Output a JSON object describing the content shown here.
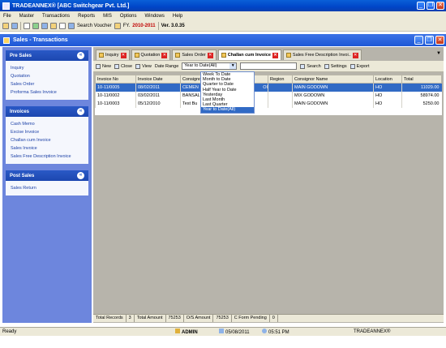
{
  "window": {
    "title": "TRADEANNEX® [ABC Switchgear Pvt. Ltd.]",
    "minimize": "_",
    "restore": "❐",
    "close": "✕"
  },
  "menu": [
    "File",
    "Master",
    "Transactions",
    "Reports",
    "MIS",
    "Options",
    "Windows",
    "Help"
  ],
  "toolbar": {
    "search_voucher": "Search Voucher",
    "fy_label": "FY.",
    "fy_value": "2010-2011",
    "version": "Ver. 3.0.35"
  },
  "mdi": {
    "title": "Sales - Transactions"
  },
  "sidebar": {
    "pre_sales": {
      "title": "Pre Sales",
      "items": [
        "Inquiry",
        "Quotation",
        "Sales Order",
        "Proforma Sales Invoice"
      ]
    },
    "invoices": {
      "title": "Invoices",
      "items": [
        "Cash Memo",
        "Excise Invoice",
        "Challan cum Invoice",
        "Sales Invoice",
        "Sales Free Description Invoice"
      ]
    },
    "post_sales": {
      "title": "Post Sales",
      "items": [
        "Sales Return"
      ]
    },
    "chevron": "«"
  },
  "tabs": [
    {
      "label": "Inquiry"
    },
    {
      "label": "Quotation"
    },
    {
      "label": "Sales Order"
    },
    {
      "label": "Challan cum Invoice"
    },
    {
      "label": "Sales Free Description Invoi.."
    }
  ],
  "tab_close": "✕",
  "tab_menu": "▼",
  "subbar": {
    "new": "New",
    "close": "Close",
    "view": "View",
    "date_range": "Date Range",
    "date_value": "Year to Date(All)",
    "search": "Search",
    "settings": "Settings",
    "export": "Export"
  },
  "dropdown": {
    "options": [
      "Week To Date",
      "Month to Date",
      "Quarter to Date",
      "Half Year to Date",
      "Yesterday",
      "Last Month",
      "Last Quarter",
      "Year to Date(All)"
    ],
    "selected": "Year to Date(All)"
  },
  "table": {
    "headers": [
      "Invoice No",
      "Invoice Date",
      "Consignor",
      "",
      "Region",
      "Consignor Name",
      "Location",
      "Total"
    ],
    "rows": [
      {
        "no": "10-11/0005",
        "date": "08/02/2011",
        "consignor": "CEMEN",
        "extra": "OI",
        "region": "",
        "name": "MAIN GODOWN",
        "location": "HO",
        "total": "11029.00"
      },
      {
        "no": "10-11/0002",
        "date": "03/02/2011",
        "consignor": "BANSAL",
        "extra": "",
        "region": "",
        "name": "MIX GODOWN",
        "location": "HO",
        "total": "58974.00"
      },
      {
        "no": "10-11/0003",
        "date": "05/12/2010",
        "consignor": "Test Bu",
        "extra": "",
        "region": "",
        "name": "MAIN GODOWN",
        "location": "HO",
        "total": "5250.00"
      }
    ]
  },
  "footer": {
    "total_records_label": "Total Records",
    "total_records": "3",
    "total_amount_label": "Total Amount",
    "total_amount": "75253",
    "os_amount_label": "O/S Amount",
    "os_amount": "75253",
    "c_form_label": "C Form Pending",
    "c_form": "0"
  },
  "status": {
    "ready": "Ready",
    "user": "ADMIN",
    "date": "05/08/2011",
    "time": "05:51 PM",
    "brand": "TRADEANNEX®"
  }
}
